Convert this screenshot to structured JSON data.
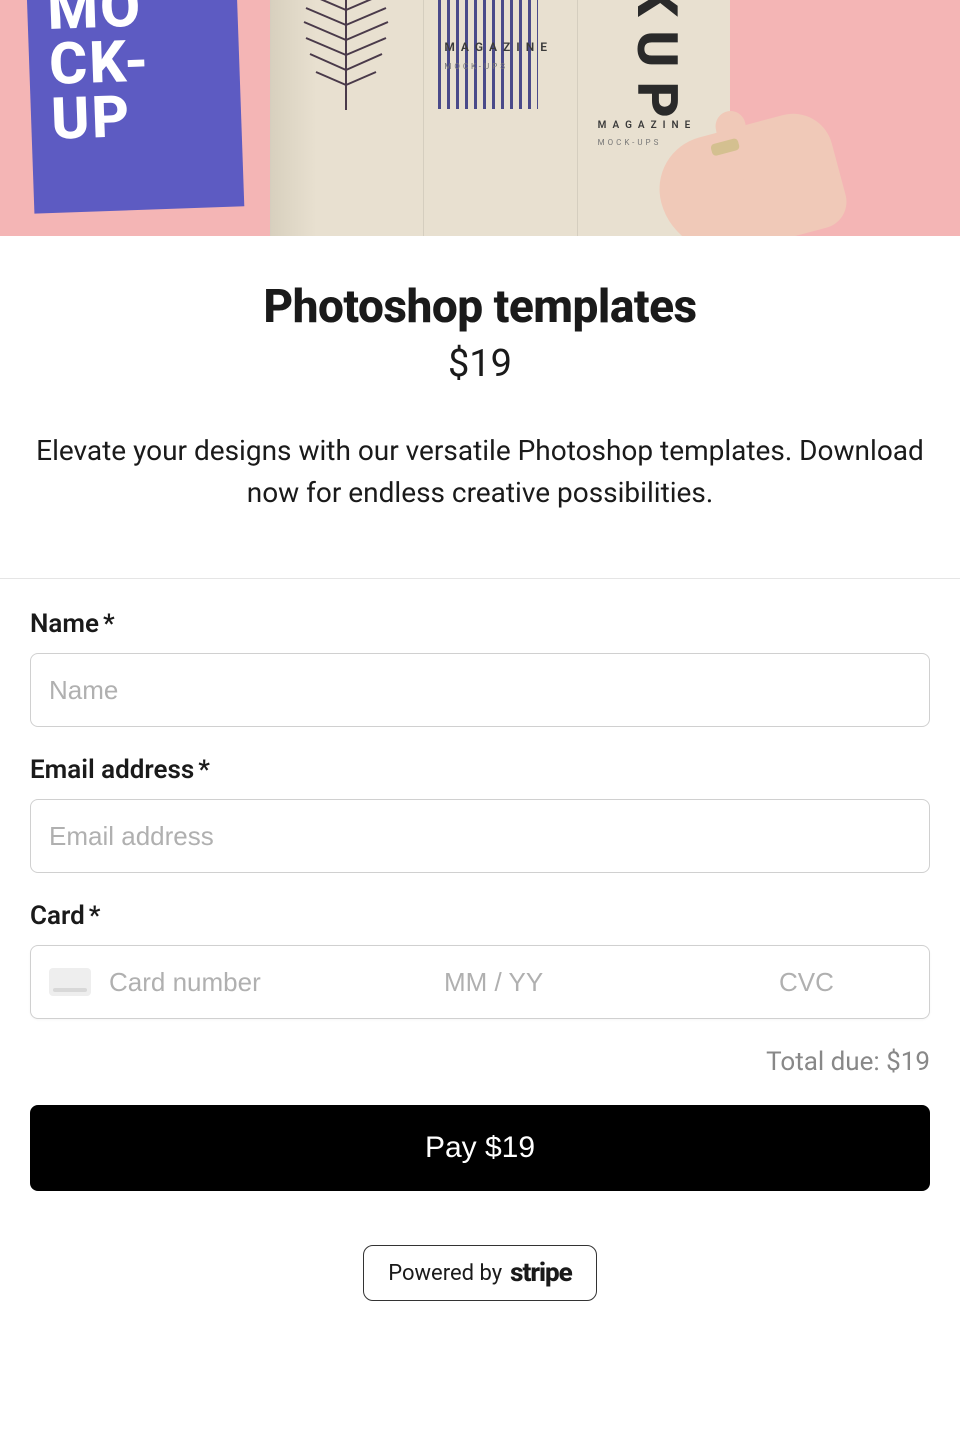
{
  "hero": {
    "left_text": "MO\nCK-\nUP",
    "magazine_label": "MAGAZINE",
    "magazine_sub": "MOCK-UPS",
    "vertical_text": "CKUP"
  },
  "product": {
    "title": "Photoshop templates",
    "price": "$19",
    "description": "Elevate your designs with our versatile Photoshop templates. Download now for endless creative possibilities."
  },
  "form": {
    "name_label": "Name",
    "name_placeholder": "Name",
    "email_label": "Email address",
    "email_placeholder": "Email address",
    "card_label": "Card",
    "card_number_placeholder": "Card number",
    "card_expiry_placeholder": "MM / YY",
    "card_cvc_placeholder": "CVC",
    "required_mark": "*"
  },
  "summary": {
    "total_label": "Total due: $19"
  },
  "actions": {
    "pay_label": "Pay $19"
  },
  "footer": {
    "powered_text": "Powered by",
    "brand": "stripe"
  }
}
